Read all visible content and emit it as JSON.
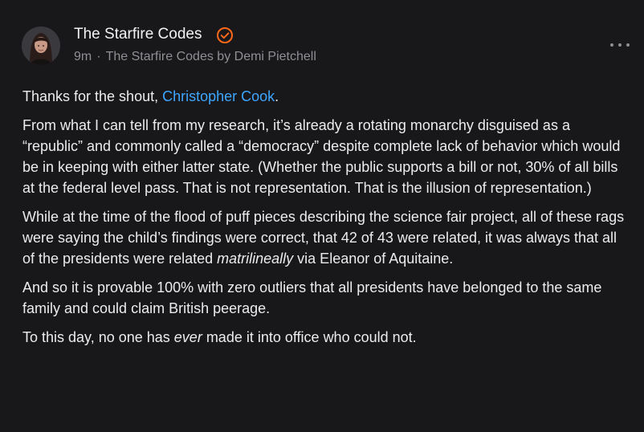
{
  "author": {
    "name": "The Starfire Codes",
    "time": "9m",
    "separator": "·",
    "publication": "The Starfire Codes by Demi Pietchell",
    "verified_color": "#ff6719",
    "avatar_icon": "avatar-photo"
  },
  "post": {
    "p1_before": "Thanks for the shout, ",
    "p1_mention": "Christopher Cook",
    "p1_after": ".",
    "p2": "From what I can tell from my research, it’s already a rotating monarchy disguised as a “republic” and commonly called a “democracy” despite complete lack of behavior which would be in keeping with either latter state. (Whether the public supports a bill or not, 30% of all bills at the federal level pass. That is not representation. That is the illusion of representation.)",
    "p3_before": "While at the time of the flood of puff pieces describing the science fair project, all of these rags were saying the child’s findings were correct, that 42 of 43 were related, it was always that all of the presidents were related ",
    "p3_em": "matrilineally",
    "p3_after": " via Eleanor of Aquitaine.",
    "p4": "And so it is provable 100% with zero outliers that all presidents have belonged to the same family and could claim British peerage.",
    "p5_before": "To this day, no one has ",
    "p5_em": "ever",
    "p5_after": " made it into office who could not."
  },
  "colors": {
    "background": "#18181b",
    "text": "#ececec",
    "muted": "#8f8f94",
    "link": "#3ea6ff",
    "accent": "#ff6719"
  }
}
